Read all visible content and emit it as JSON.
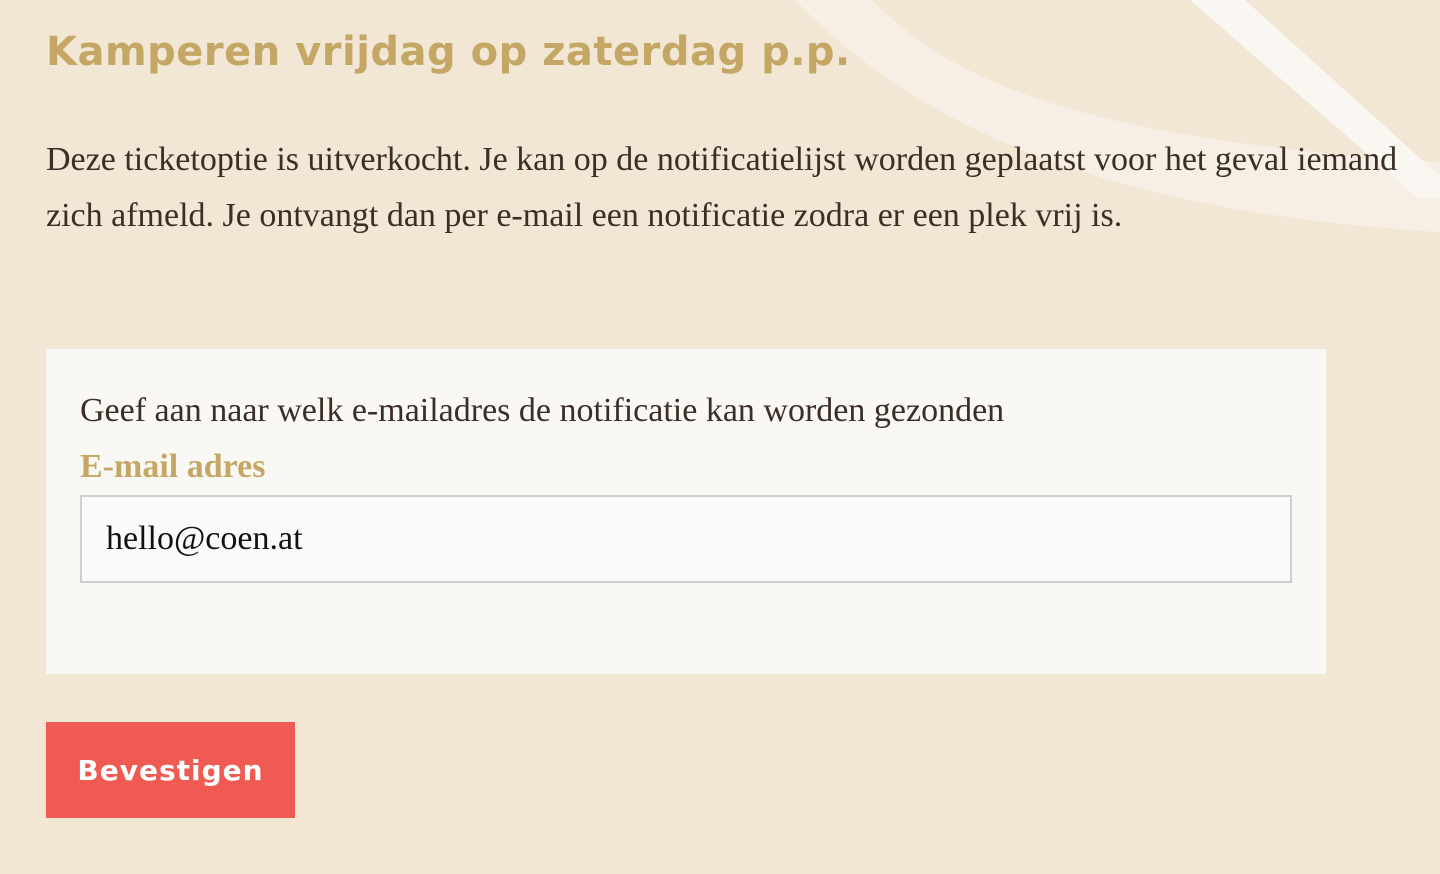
{
  "colors": {
    "page_background": "#f2e6d5",
    "accent_gold": "#c4a764",
    "body_text": "#3a2e26",
    "card_background": "#faf8f4",
    "button_background": "#ef5b52",
    "button_text": "#ffffff"
  },
  "page": {
    "title": "Kamperen vrijdag op zaterdag p.p.",
    "intro": "Deze ticketoptie is uitverkocht. Je kan op de notificatielijst worden geplaatst voor het geval iemand zich afmeld. Je ontvangt dan per e-mail een notificatie zodra er een plek vrij is."
  },
  "form": {
    "instruction": "Geef aan naar welk e-mailadres de notificatie kan worden gezonden",
    "email_label": "E-mail adres",
    "email_value": "hello@coen.at"
  },
  "actions": {
    "confirm_label": "Bevestigen"
  }
}
